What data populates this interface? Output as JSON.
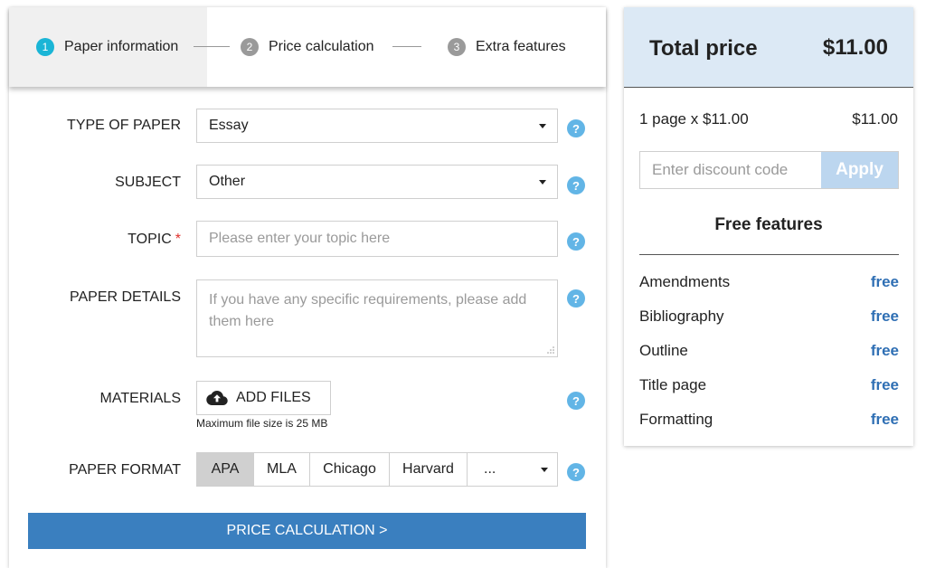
{
  "steps": [
    {
      "number": "1",
      "label": "Paper information"
    },
    {
      "number": "2",
      "label": "Price calculation"
    },
    {
      "number": "3",
      "label": "Extra features"
    }
  ],
  "form": {
    "type_of_paper": {
      "label": "TYPE OF PAPER",
      "value": "Essay"
    },
    "subject": {
      "label": "SUBJECT",
      "value": "Other"
    },
    "topic": {
      "label": "TOPIC",
      "required_mark": "*",
      "placeholder": "Please enter your topic here"
    },
    "paper_details": {
      "label": "PAPER DETAILS",
      "placeholder": "If you have any specific requirements, please add them here"
    },
    "materials": {
      "label": "MATERIALS",
      "button": "ADD FILES",
      "note": "Maximum file size is 25 MB"
    },
    "paper_format": {
      "label": "PAPER FORMAT",
      "options": [
        "APA",
        "MLA",
        "Chicago",
        "Harvard",
        "..."
      ],
      "selected": "APA"
    },
    "help_glyph": "?",
    "submit": "PRICE CALCULATION >"
  },
  "summary": {
    "title": "Total price",
    "total": "$11.00",
    "line_item": "1 page x $11.00",
    "line_price": "$11.00",
    "discount_placeholder": "Enter discount code",
    "apply": "Apply",
    "free_title": "Free features",
    "features": [
      {
        "name": "Amendments",
        "value": "free"
      },
      {
        "name": "Bibliography",
        "value": "free"
      },
      {
        "name": "Outline",
        "value": "free"
      },
      {
        "name": "Title page",
        "value": "free"
      },
      {
        "name": "Formatting",
        "value": "free"
      }
    ]
  },
  "colors": {
    "accent_blue": "#3a7fbf",
    "step_active": "#1ab5d6",
    "help_icon": "#62b5e6",
    "free_link": "#2f6fb4",
    "summary_header": "#dce9f5"
  },
  "icons": [
    "help-icon",
    "cloud-upload-icon",
    "chevron-down-icon"
  ]
}
